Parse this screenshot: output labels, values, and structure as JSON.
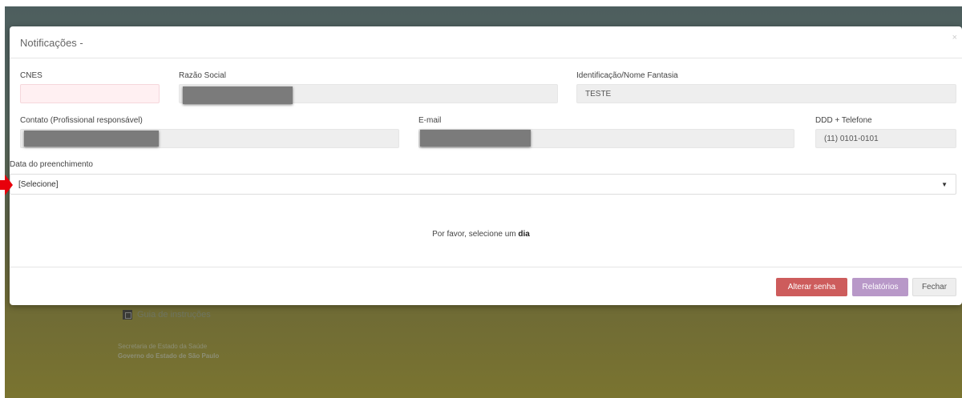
{
  "background": {
    "guide_label": "Guia de instruções",
    "secretaria": "Secretaria de Estado da Saúde",
    "governo": "Governo do Estado de São Paulo"
  },
  "modal": {
    "title": "Notificações -",
    "close_glyph": "×",
    "fields": {
      "cnes_label": "CNES",
      "cnes_value": "",
      "razao_label": "Razão Social",
      "identificacao_label": "Identificação/Nome Fantasia",
      "identificacao_value": "TESTE",
      "contato_label": "Contato (Profissional responsável)",
      "email_label": "E-mail",
      "telefone_label": "DDD + Telefone",
      "telefone_value": "(11) 0101-0101"
    },
    "date": {
      "label": "Data do preenchimento",
      "selected": "[Selecione]"
    },
    "message_prefix": "Por favor, selecione um ",
    "message_bold": "dia",
    "buttons": {
      "alterar_senha": "Alterar senha",
      "relatorios": "Relatórios",
      "fechar": "Fechar"
    }
  },
  "colors": {
    "danger": "#cd5c5c",
    "purple": "#b898c8",
    "arrow": "#e8000b"
  }
}
